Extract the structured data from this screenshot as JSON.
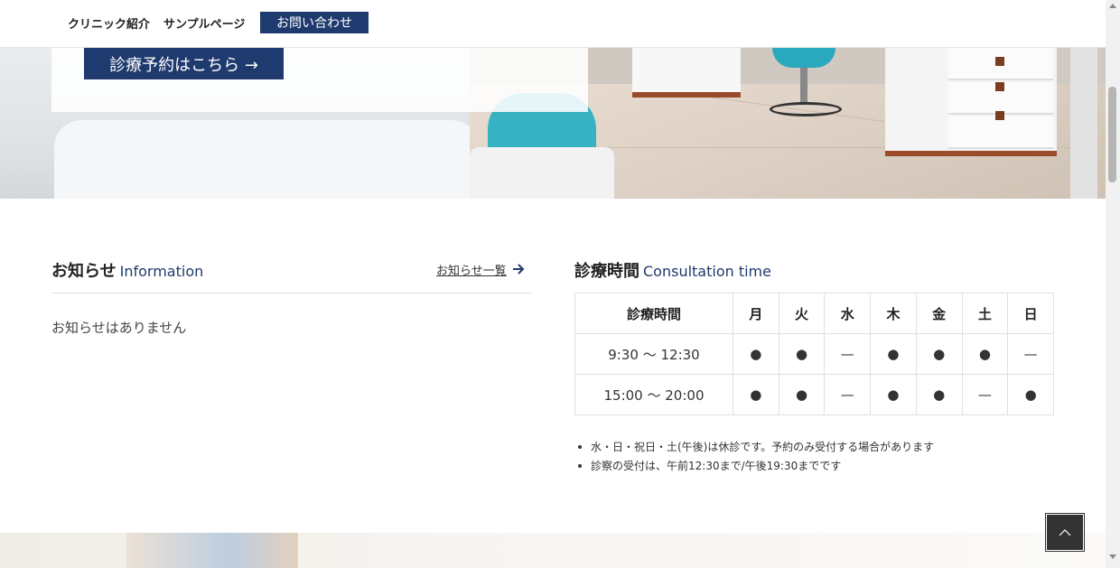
{
  "header": {
    "nav": {
      "clinic": "クリニック紹介",
      "sample": "サンプルページ",
      "contact": "お問い合わせ"
    }
  },
  "hero": {
    "reserve_button": "診療予約はこちら →"
  },
  "information": {
    "title": "お知らせ",
    "title_en": "Information",
    "more_link": "お知らせ一覧",
    "more_icon": "arrow-right-icon",
    "empty_message": "お知らせはありません"
  },
  "consultation": {
    "title": "診療時間",
    "title_en": "Consultation time",
    "table": {
      "headers": [
        "診療時間",
        "月",
        "火",
        "水",
        "木",
        "金",
        "土",
        "日"
      ],
      "rows": [
        {
          "time": "9:30 〜 12:30",
          "marks": [
            "●",
            "●",
            "—",
            "●",
            "●",
            "●",
            "—"
          ]
        },
        {
          "time": "15:00 〜 20:00",
          "marks": [
            "●",
            "●",
            "—",
            "●",
            "●",
            "—",
            "●"
          ]
        }
      ]
    },
    "notes": [
      "水・日・祝日・土(午後)は休診です。予約のみ受付する場合があります",
      "診察の受付は、午前12:30まで/午後19:30までです"
    ]
  },
  "pagetop": {
    "icon": "chevron-up-icon",
    "label": "^"
  },
  "colors": {
    "accent": "#1f3a6e",
    "text": "#333333",
    "pagetop_bg": "#333333"
  }
}
